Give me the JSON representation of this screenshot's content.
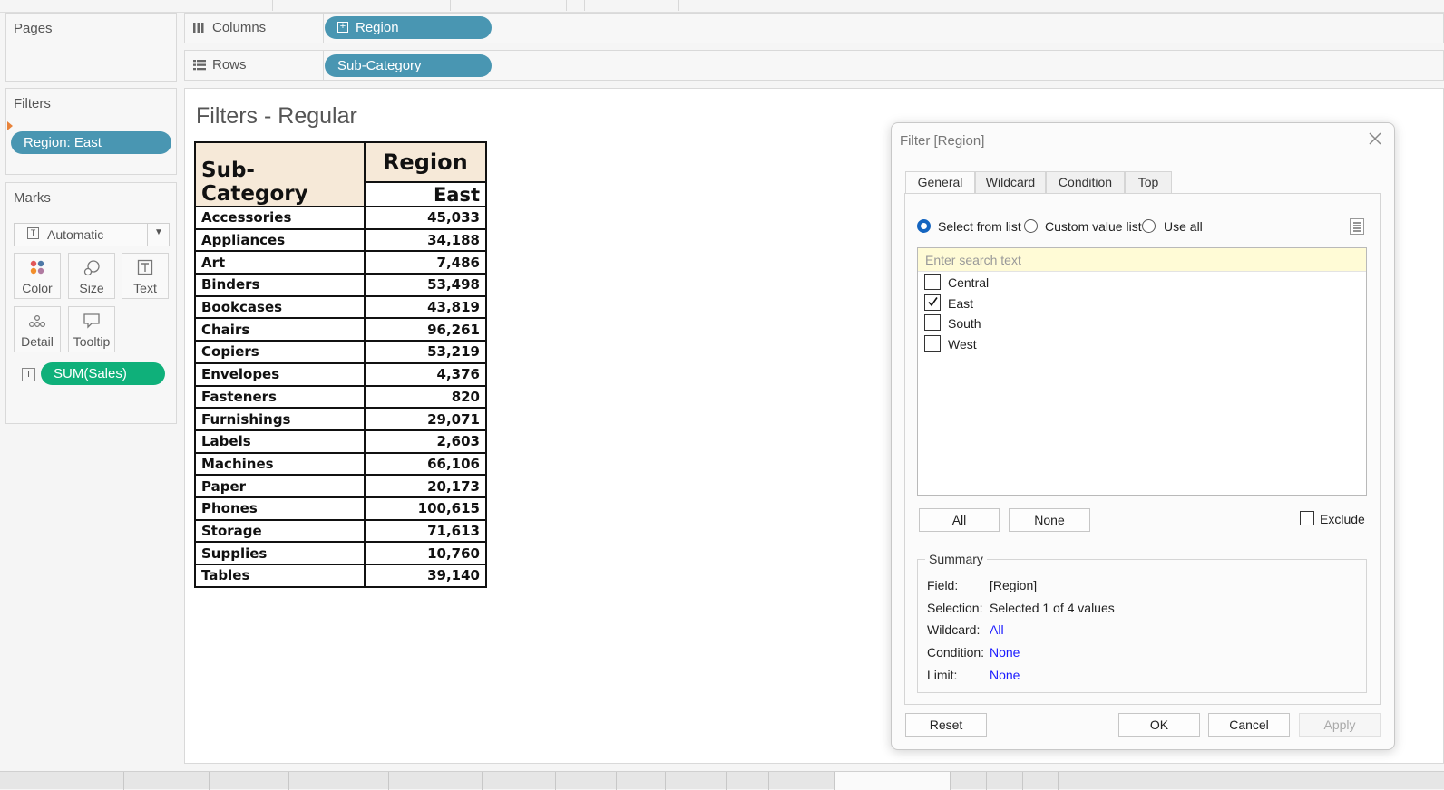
{
  "cards": {
    "pages_title": "Pages",
    "filters_title": "Filters",
    "filter_pill": "Region: East",
    "marks_title": "Marks",
    "mark_type": "Automatic",
    "mark_buttons": [
      "Color",
      "Size",
      "Text",
      "Detail",
      "Tooltip"
    ],
    "measure_pill": "SUM(Sales)"
  },
  "shelves": {
    "columns_label": "Columns",
    "columns_pill": "Region",
    "rows_label": "Rows",
    "rows_pill": "Sub-Category"
  },
  "sheet": {
    "title": "Filters - Regular",
    "row_header": "Sub-Category",
    "col_header": "Region",
    "col_value": "East",
    "rows": [
      {
        "name": "Accessories",
        "value": "45,033"
      },
      {
        "name": "Appliances",
        "value": "34,188"
      },
      {
        "name": "Art",
        "value": "7,486"
      },
      {
        "name": "Binders",
        "value": "53,498"
      },
      {
        "name": "Bookcases",
        "value": "43,819"
      },
      {
        "name": "Chairs",
        "value": "96,261"
      },
      {
        "name": "Copiers",
        "value": "53,219"
      },
      {
        "name": "Envelopes",
        "value": "4,376"
      },
      {
        "name": "Fasteners",
        "value": "820"
      },
      {
        "name": "Furnishings",
        "value": "29,071"
      },
      {
        "name": "Labels",
        "value": "2,603"
      },
      {
        "name": "Machines",
        "value": "66,106"
      },
      {
        "name": "Paper",
        "value": "20,173"
      },
      {
        "name": "Phones",
        "value": "100,615"
      },
      {
        "name": "Storage",
        "value": "71,613"
      },
      {
        "name": "Supplies",
        "value": "10,760"
      },
      {
        "name": "Tables",
        "value": "39,140"
      }
    ]
  },
  "dialog": {
    "title": "Filter [Region]",
    "tabs": [
      "General",
      "Wildcard",
      "Condition",
      "Top"
    ],
    "active_tab": "General",
    "radio_options": [
      "Select from list",
      "Custom value list",
      "Use all"
    ],
    "selected_radio": "Select from list",
    "search_placeholder": "Enter search text",
    "values": [
      {
        "label": "Central",
        "checked": false
      },
      {
        "label": "East",
        "checked": true
      },
      {
        "label": "South",
        "checked": false
      },
      {
        "label": "West",
        "checked": false
      }
    ],
    "all_button": "All",
    "none_button": "None",
    "exclude_label": "Exclude",
    "exclude_checked": false,
    "summary": {
      "legend": "Summary",
      "field_label": "Field:",
      "field_value": "[Region]",
      "selection_label": "Selection:",
      "selection_value": "Selected 1 of 4 values",
      "wildcard_label": "Wildcard:",
      "wildcard_value": "All",
      "condition_label": "Condition:",
      "condition_value": "None",
      "limit_label": "Limit:",
      "limit_value": "None"
    },
    "reset_button": "Reset",
    "ok_button": "OK",
    "cancel_button": "Cancel",
    "apply_button": "Apply"
  },
  "colors": {
    "pill_blue": "#4996b2",
    "pill_green": "#0fb07a",
    "header_fill": "#f6e9d8",
    "radio_selected": "#1565c0",
    "link": "#1a1aff"
  }
}
